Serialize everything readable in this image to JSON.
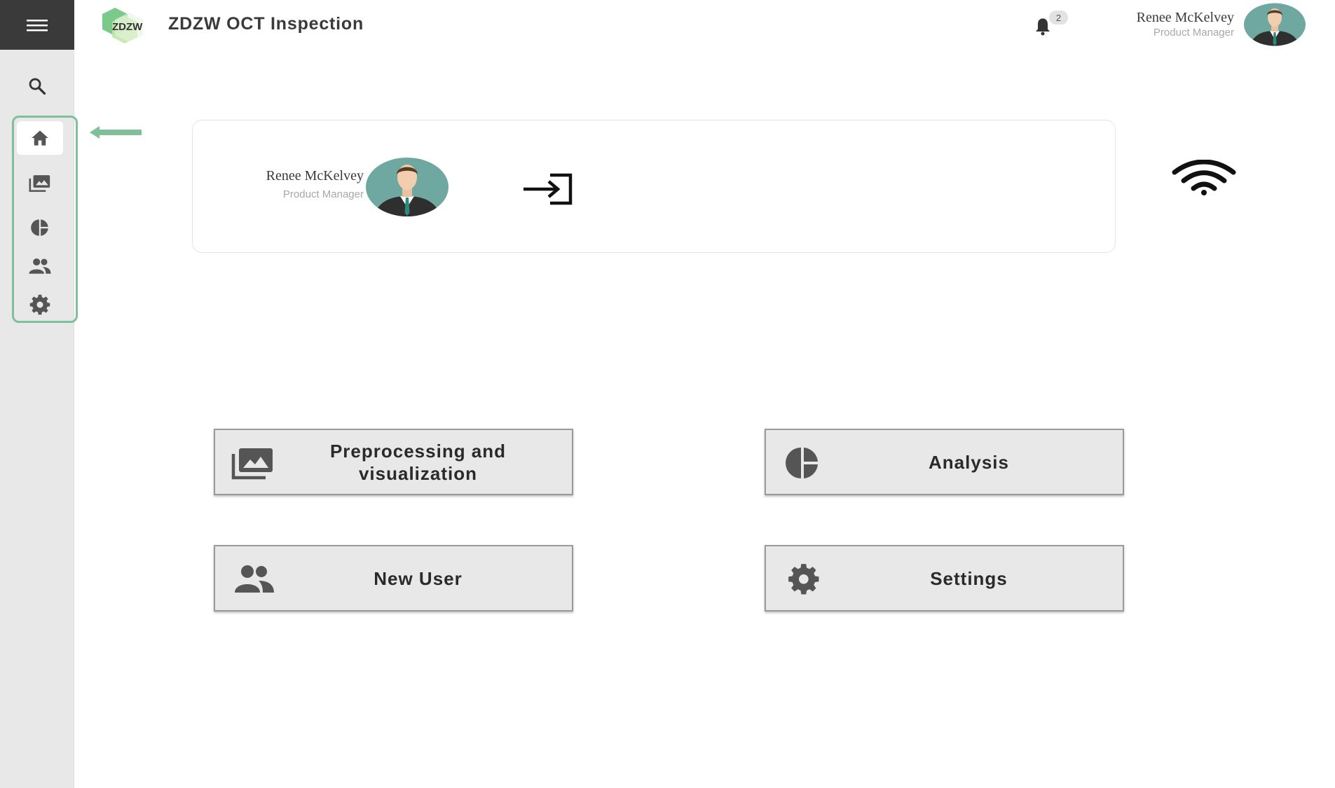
{
  "app": {
    "title": "ZDZW OCT Inspection",
    "logo_text": "ZDZW",
    "accent_color": "#7fbf9a"
  },
  "header": {
    "notification_count": "2",
    "user_name": "Renee McKelvey",
    "user_role": "Product Manager"
  },
  "sidebar": {
    "items": [
      {
        "name": "home",
        "icon": "home-icon",
        "active": true
      },
      {
        "name": "preprocessing",
        "icon": "photo-library-icon"
      },
      {
        "name": "analysis",
        "icon": "pie-chart-icon"
      },
      {
        "name": "users",
        "icon": "users-icon"
      },
      {
        "name": "settings",
        "icon": "gear-icon"
      }
    ]
  },
  "profile_card": {
    "user_name": "Renee McKelvey",
    "user_role": "Product Manager"
  },
  "tiles": {
    "preprocessing": "Preprocessing and visualization",
    "analysis": "Analysis",
    "new_user": "New User",
    "settings": "Settings"
  }
}
